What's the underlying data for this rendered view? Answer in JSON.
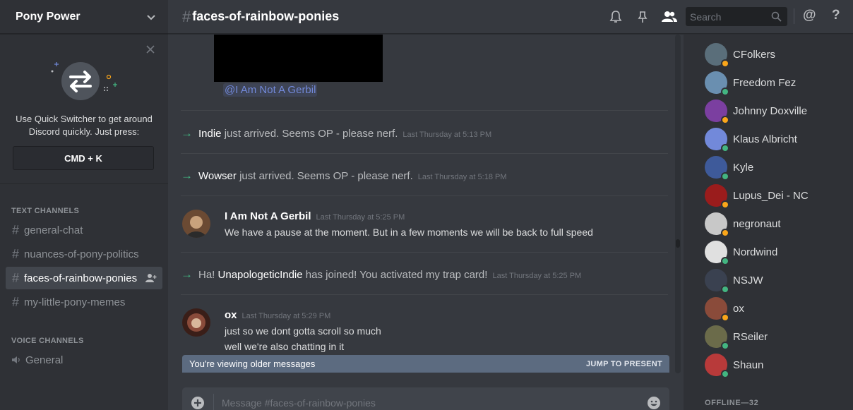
{
  "guild": {
    "name": "Pony Power"
  },
  "quick_switcher": {
    "text": "Use Quick Switcher to get around Discord quickly. Just press:",
    "shortcut": "CMD + K"
  },
  "sidebar": {
    "text_category": "TEXT CHANNELS",
    "text_channels": [
      {
        "hash": "#",
        "name": "general-chat",
        "active": false
      },
      {
        "hash": "#",
        "name": "nuances-of-pony-politics",
        "active": false
      },
      {
        "hash": "#",
        "name": "faces-of-rainbow-ponies",
        "active": true
      },
      {
        "hash": "#",
        "name": "my-little-pony-memes",
        "active": false
      }
    ],
    "voice_category": "VOICE CHANNELS",
    "voice_channels": [
      {
        "name": "General"
      }
    ]
  },
  "header": {
    "hash": "#",
    "channel_name": "faces-of-rainbow-ponies",
    "search_placeholder": "Search",
    "mention_icon": "@",
    "help_icon": "?"
  },
  "chat": {
    "mention": "@I Am Not A Gerbil",
    "system1": {
      "who": "Indie",
      "text": "just arrived. Seems OP - please nerf.",
      "time": "Last Thursday at 5:13 PM"
    },
    "system2": {
      "who": "Wowser",
      "text": "just arrived. Seems OP - please nerf.",
      "time": "Last Thursday at 5:18 PM"
    },
    "msg1": {
      "author": "I Am Not A Gerbil",
      "time": "Last Thursday at 5:25 PM",
      "lines": [
        "We have a pause at the moment. But in a few moments we will be back to full speed"
      ]
    },
    "system3": {
      "prefix": "Ha!",
      "who": "UnapologeticIndie",
      "text": "has joined! You activated my trap card!",
      "time": "Last Thursday at 5:25 PM"
    },
    "msg2": {
      "author": "ox",
      "time": "Last Thursday at 5:29 PM",
      "lines": [
        "just so we dont gotta scroll so much",
        "well we're also chatting in it"
      ]
    },
    "older_banner": "You're viewing older messages",
    "jump_label": "JUMP TO PRESENT",
    "composer_placeholder": "Message #faces-of-rainbow-ponies"
  },
  "members": [
    {
      "name": "CFolkers",
      "status": "idle"
    },
    {
      "name": "Freedom Fez",
      "status": "online"
    },
    {
      "name": "Johnny Doxville",
      "status": "idle"
    },
    {
      "name": "Klaus Albricht",
      "status": "online"
    },
    {
      "name": "Kyle",
      "status": "online"
    },
    {
      "name": "Lupus_Dei - NC",
      "status": "idle"
    },
    {
      "name": "negronaut",
      "status": "idle"
    },
    {
      "name": "Nordwind",
      "status": "online"
    },
    {
      "name": "NSJW",
      "status": "online"
    },
    {
      "name": "ox",
      "status": "idle"
    },
    {
      "name": "RSeiler",
      "status": "online"
    },
    {
      "name": "Shaun",
      "status": "online"
    }
  ],
  "offline_header": "OFFLINE—32",
  "colors": {
    "online": "#43b581",
    "idle": "#faa61a",
    "accent": "#7289da",
    "join_arrow": "#43b581"
  }
}
